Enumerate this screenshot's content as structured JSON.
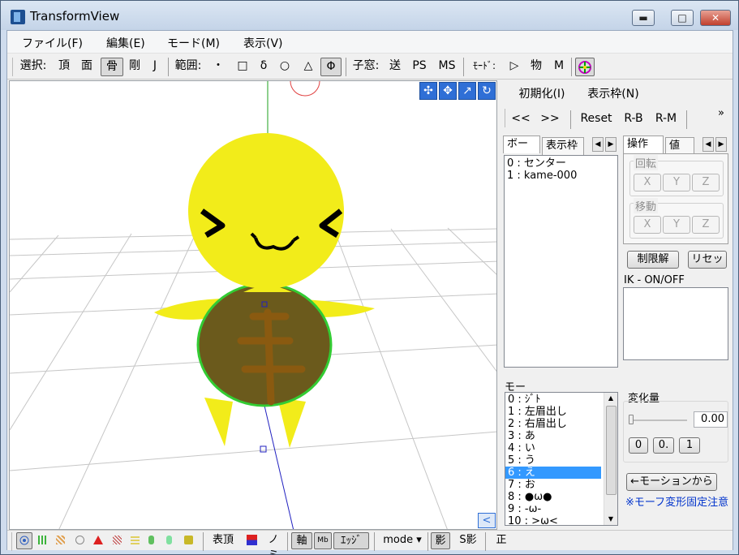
{
  "window": {
    "title": "TransformView",
    "min_label": "▬",
    "max_label": "□",
    "close_label": "✕"
  },
  "menu": [
    "ファイル(F)",
    "編集(E)",
    "モード(M)",
    "表示(V)"
  ],
  "toolbar": {
    "select_label": "選択:",
    "vertex": "頂",
    "face": "面",
    "bone": "骨",
    "rigid": "剛",
    "joint": "J",
    "range_label": "範囲:",
    "range_dot": "・",
    "range_square": "□",
    "range_delta": "δ",
    "range_circle": "○",
    "range_triangle": "△",
    "range_phi": "Φ",
    "child_label": "子窓:",
    "send": "送",
    "ps": "PS",
    "ms": "MS",
    "mode_label": "ﾓｰﾄﾞ:",
    "play": "▷",
    "physics": "物",
    "m": "M"
  },
  "right_panel": {
    "init_label": "初期化(I)",
    "frame_label": "表示枠(N)",
    "prev": "<<",
    "next": ">>",
    "reset": "Reset",
    "rb": "R-B",
    "rm": "R-M",
    "more": "»",
    "tabs_left": [
      "ボーン",
      "表示枠"
    ],
    "tabs_right": [
      "操作",
      "値"
    ],
    "bones": [
      "0 : センター",
      "1 : kame-000"
    ],
    "rotate_label": "回転",
    "move_label": "移動",
    "x": "X",
    "y": "Y",
    "z": "Z",
    "unlock_label": "制限解",
    "resetbtn_label": "リセッ",
    "ik_label": "IK - ON/OFF",
    "morph_label": "モー",
    "morphs": [
      "0 : ｼﾞﾄ",
      "1 : 左眉出し",
      "2 : 右眉出し",
      "3 : あ",
      "4 : い",
      "5 : う",
      "6 : え",
      "7 : お",
      "8 : ●ω●",
      "9 : -ω-",
      "10 : >ω<"
    ],
    "selected_morph_index": 6,
    "change_label": "変化量",
    "change_value": "0.00",
    "val_0": "0",
    "val_05": "0.",
    "val_1": "1",
    "from_motion": "←モーションから",
    "note": "※モーフ変形固定注意"
  },
  "statusbar": {
    "front_vertex": "表頂",
    "nomi": "ノミ",
    "axis": "軸",
    "mb": "Mb",
    "edge": "ｴｯｼﾞ",
    "mode": "mode ▾",
    "shadow": "影",
    "sshadow": "S影",
    "front": "正"
  },
  "viewport": {
    "collapse": "<"
  },
  "colors": {
    "accent": "#3399ff",
    "model_yellow": "#f2ec1a",
    "shell_brown": "#6b5a1c",
    "outline_green": "#33cc33"
  }
}
